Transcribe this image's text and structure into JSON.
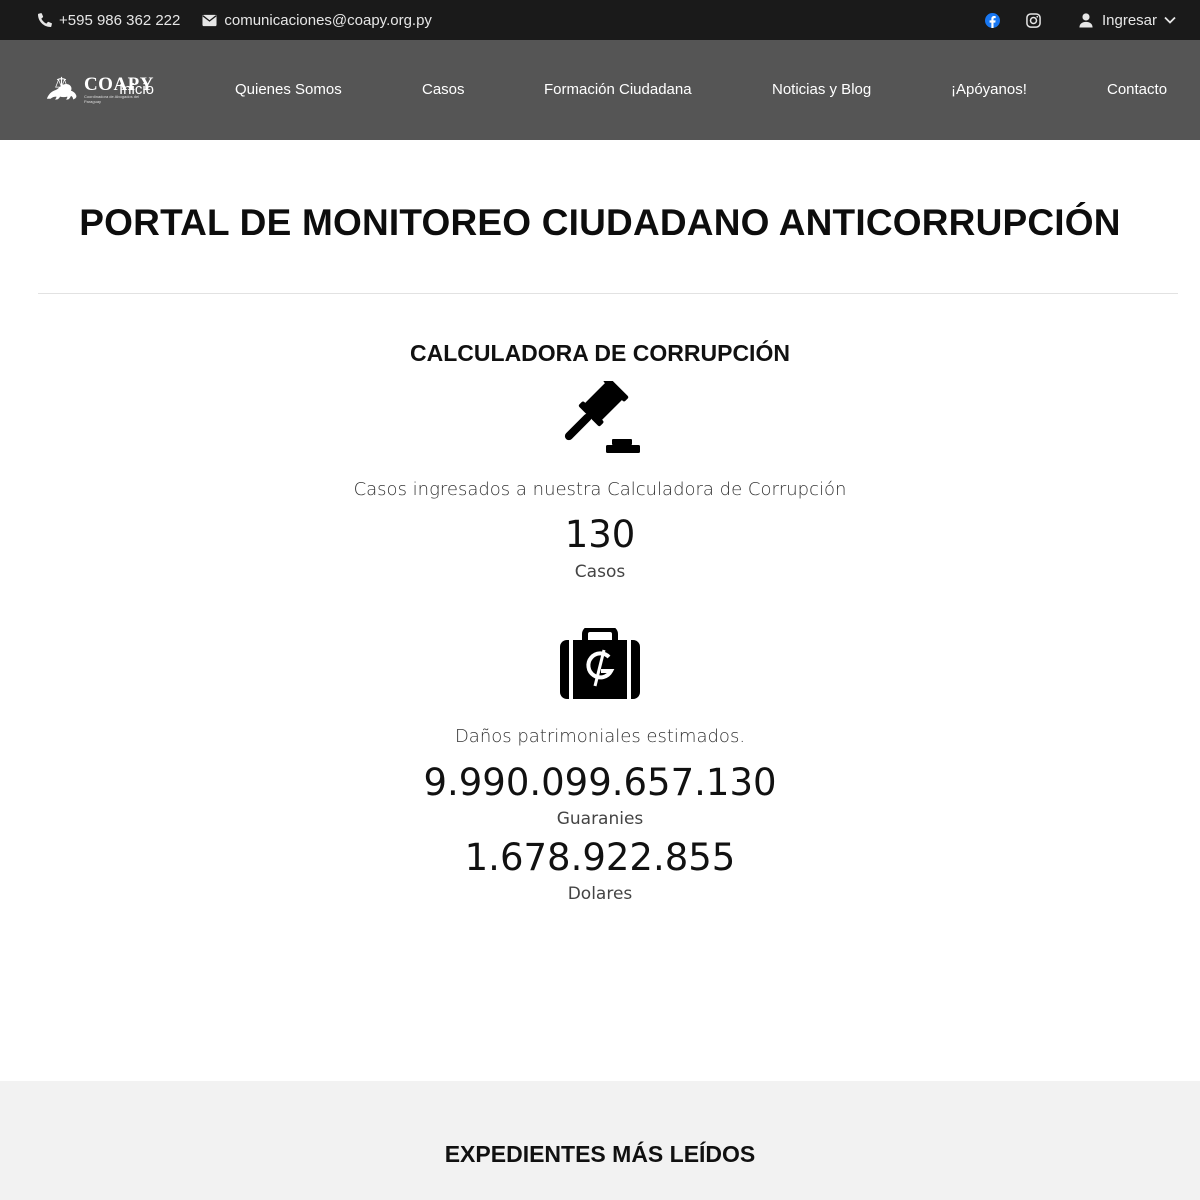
{
  "topbar": {
    "phone": "+595 986 362 222",
    "email": "comunicaciones@coapy.org.py",
    "login_label": "Ingresar",
    "icons": [
      "phone-icon",
      "envelope-icon",
      "facebook-icon",
      "instagram-icon",
      "user-icon",
      "chevron-down-icon"
    ],
    "facebook_color": "#1877f2"
  },
  "logo": {
    "wordmark": "COAPY",
    "tagline": "Coordinadora de Abogados del Paraguay"
  },
  "nav": {
    "items": [
      "Inicio",
      "Quienes Somos",
      "Casos",
      "Formación Ciudadana",
      "Noticias y Blog",
      "¡Apóyanos!",
      "Contacto"
    ]
  },
  "main": {
    "title": "PORTAL DE MONITOREO CIUDADANO ANTICORRUPCIÓN",
    "calculator_title": "CALCULADORA DE CORRUPCIÓN",
    "cases": {
      "label": "Casos ingresados a nuestra Calculadora de Corrupción",
      "value": "130",
      "unit": "Casos"
    },
    "damages": {
      "label": "Daños patrimoniales estimados.",
      "guaranies_value": "9.990.099.657.130",
      "guaranies_unit": "Guaranies",
      "dollars_value": "1.678.922.855",
      "dollars_unit": "Dolares"
    }
  },
  "section_most_read": {
    "title": "EXPEDIENTES MÁS LEÍDOS"
  },
  "colors": {
    "topbar_bg": "#1a1a1a",
    "nav_bg": "#555555",
    "section_bg": "#f2f2f2"
  }
}
